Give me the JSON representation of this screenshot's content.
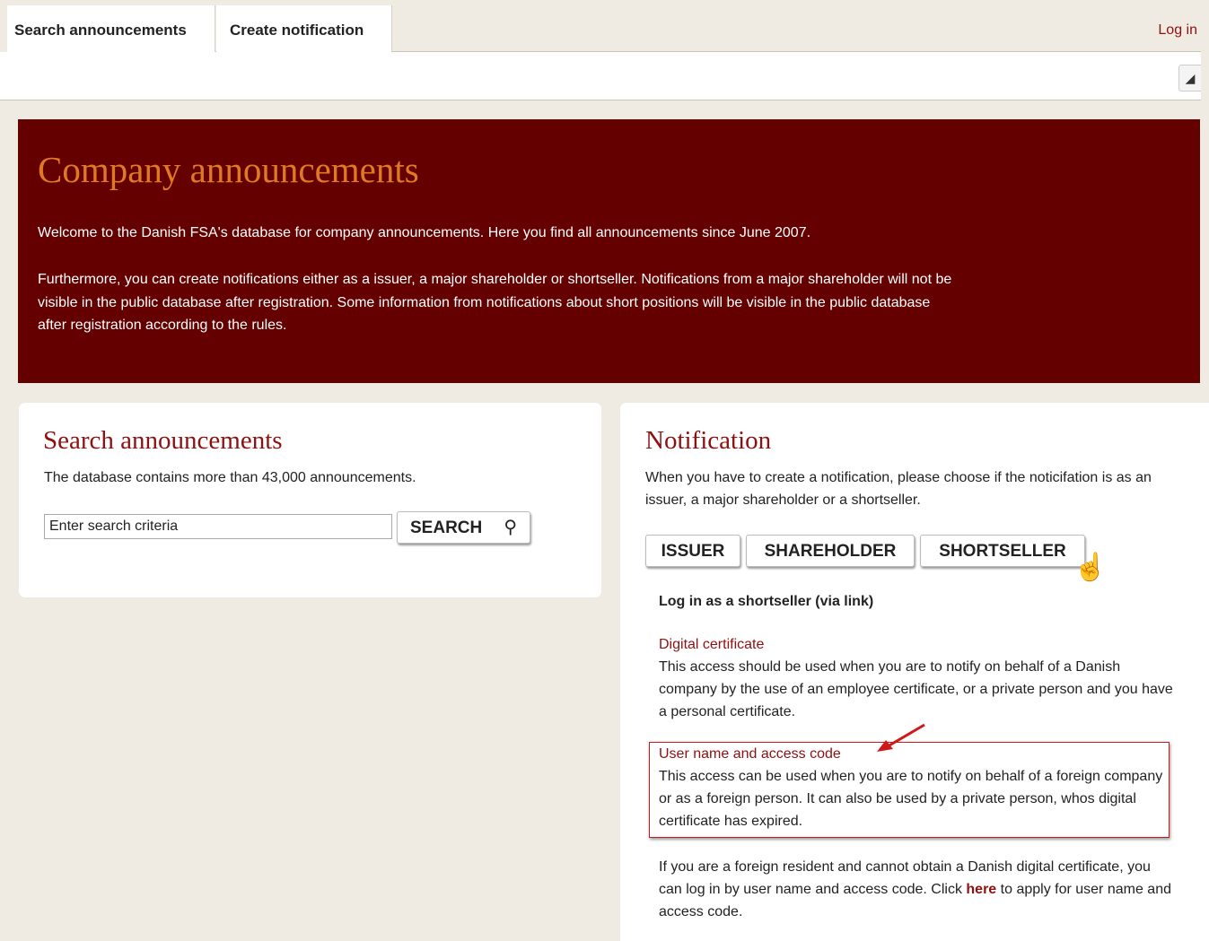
{
  "nav": {
    "tabs": [
      "Search announcements",
      "Create notification"
    ],
    "login": "Log in",
    "speaker_icon": "speaker-icon"
  },
  "hero": {
    "title": "Company announcements",
    "p1": "Welcome to the Danish FSA's database for company announcements. Here you find all announcements since June 2007.",
    "p2": "Furthermore, you can create notifications either as a issuer, a major shareholder or shortseller. Notifications from a major shareholder will not be visible in the public database after registration. Some information from notifications about short positions will be visible in the public database after registration according to the rules."
  },
  "search": {
    "title": "Search announcements",
    "desc": "The database contains more than 43,000 announcements.",
    "input_value": "Enter search criteria",
    "button": "SEARCH"
  },
  "notification": {
    "title": "Notification",
    "desc": "When you have to create a notification, please choose if the noticifation is as an issuer, a major shareholder or a shortseller.",
    "roles": [
      "ISSUER",
      "SHAREHOLDER",
      "SHORTSELLER"
    ],
    "login_heading": "Log in as a shortseller (via link)",
    "digital_cert_heading": "Digital certificate",
    "digital_cert_text": "This access should be used when you are to notify on behalf of a Danish company by the use of an employee certificate, or a private person and you have a personal certificate.",
    "user_code_heading": "User name and access code",
    "user_code_text": "This access can be used when you are to notify on behalf of a foreign company or as a foreign person. It can also be used by a private person, whos digital certificate has expired.",
    "foreign_text_before": "If you are a foreign resident and cannot obtain a Danish digital certificate, you can log in by user name and access code. Click ",
    "foreign_link": "here",
    "foreign_text_after": " to apply for user name and access code."
  },
  "colors": {
    "hero_bg": "#650000",
    "title_orange": "#e07a22",
    "link_red": "#8e1010",
    "page_bg": "#efebe3",
    "highlight": "#d01818"
  }
}
